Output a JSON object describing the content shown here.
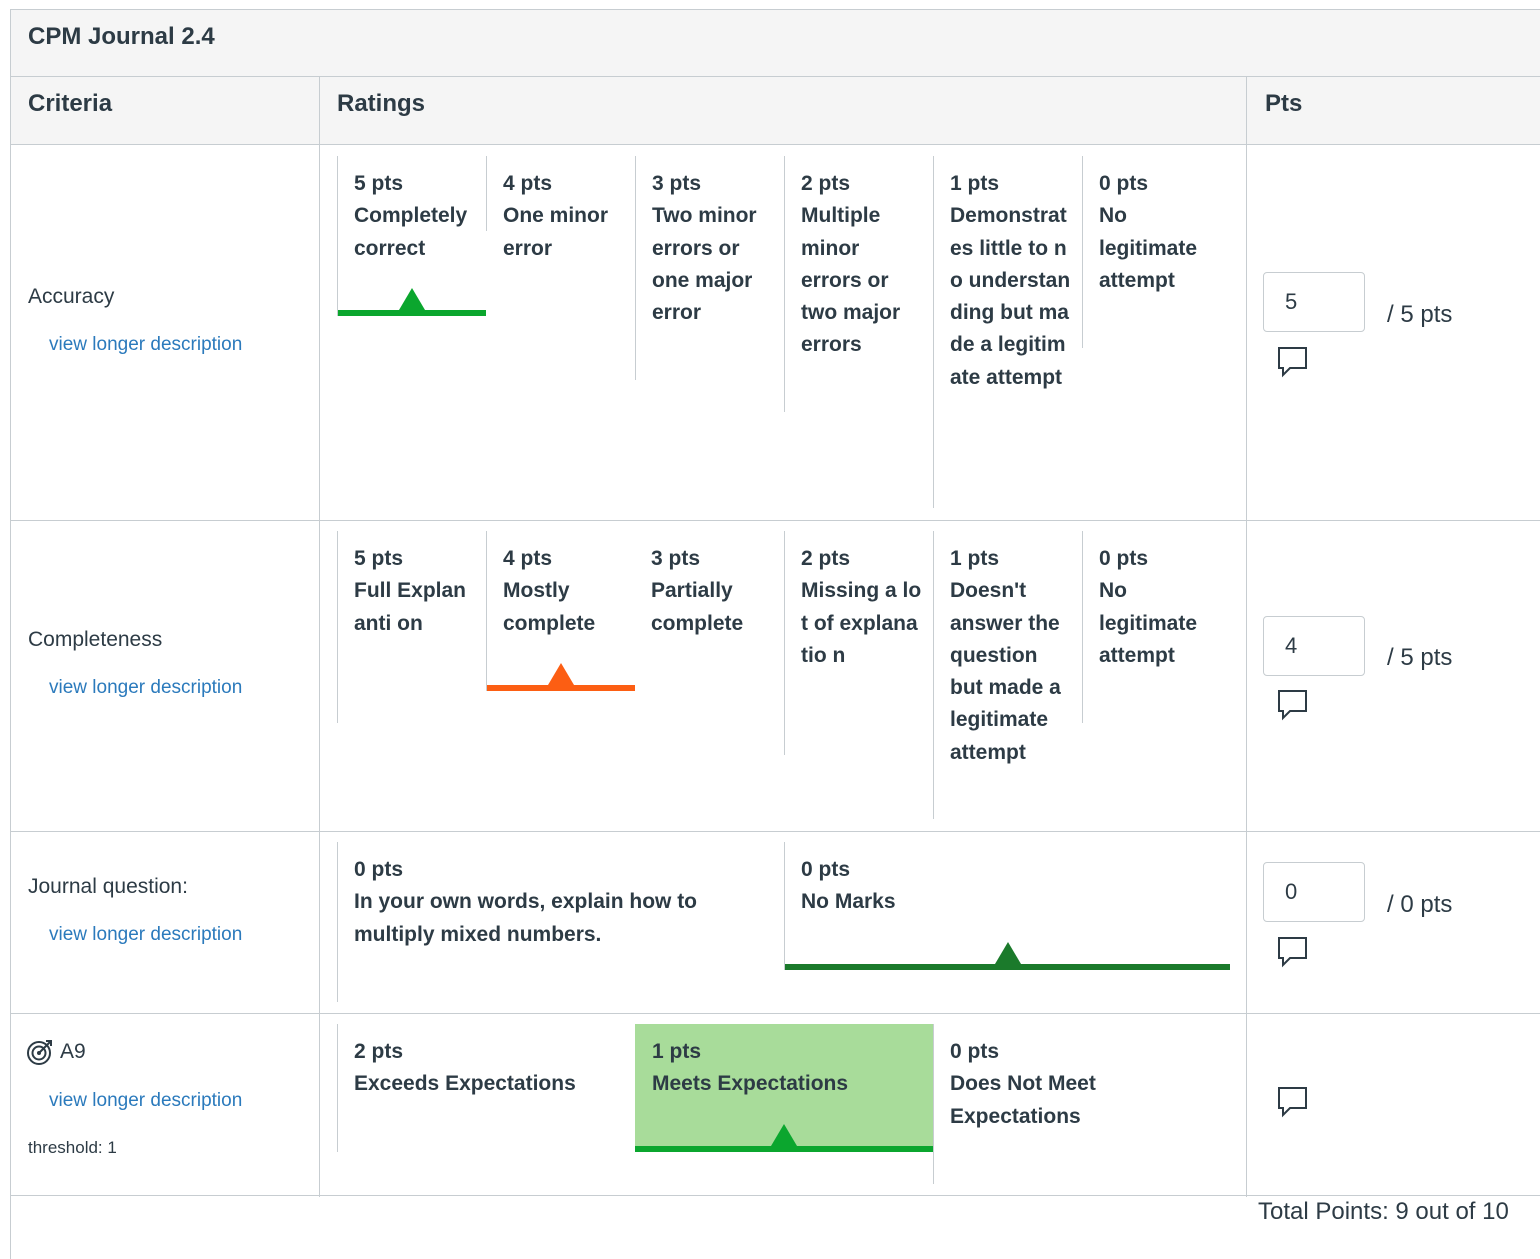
{
  "rubric": {
    "title": "CPM Journal 2.4",
    "headers": {
      "criteria": "Criteria",
      "ratings": "Ratings",
      "pts": "Pts"
    },
    "view_longer_label": "view longer description",
    "criteria": [
      {
        "name": "Accuracy",
        "score": "5",
        "out_of": "/ 5 pts",
        "ratings": [
          {
            "pts": "5 pts",
            "desc": "Completely correct",
            "selected": true
          },
          {
            "pts": "4 pts",
            "desc": "One minor error"
          },
          {
            "pts": "3 pts",
            "desc": "Two minor errors or one major error"
          },
          {
            "pts": "2 pts",
            "desc": "Multiple minor errors or two major errors"
          },
          {
            "pts": "1 pts",
            "desc": "Demonstrates little to no understanding but made a legitimate attempt"
          },
          {
            "pts": "0 pts",
            "desc": "No legitimate attempt"
          }
        ]
      },
      {
        "name": "Completeness",
        "score": "4",
        "out_of": "/ 5 pts",
        "ratings": [
          {
            "pts": "5 pts",
            "desc": "Full Explananti on"
          },
          {
            "pts": "4 pts",
            "desc": "Mostly complete",
            "selected": true
          },
          {
            "pts": "3 pts",
            "desc": "Partially complete"
          },
          {
            "pts": "2 pts",
            "desc": "Missing a lot of explanatio n"
          },
          {
            "pts": "1 pts",
            "desc": "Doesn't answer the question but made a legitimate attempt"
          },
          {
            "pts": "0 pts",
            "desc": "No legitimate attempt"
          }
        ]
      },
      {
        "name": "Journal question:",
        "score": "0",
        "out_of": "/ 0 pts",
        "ratings": [
          {
            "pts": "0 pts",
            "desc": "In your own words, explain how to multiply mixed numbers."
          },
          {
            "pts": "0 pts",
            "desc": "No Marks",
            "selected": true
          }
        ]
      },
      {
        "name": "A9",
        "threshold": "threshold: 1",
        "ratings": [
          {
            "pts": "2 pts",
            "desc": "Exceeds Expectations"
          },
          {
            "pts": "1 pts",
            "desc": "Meets Expectations",
            "selected": true
          },
          {
            "pts": "0 pts",
            "desc": "Does Not Meet Expectations"
          }
        ]
      }
    ],
    "total": "Total Points: 9 out of 10",
    "colors": {
      "selected_green": "#0ba62e",
      "selected_orange": "#fc5e13",
      "selected_dark_green": "#1b7a2b",
      "highlight_bg": "#a8dc9a",
      "link": "#2b7abc",
      "border": "#c7cdd1",
      "header_bg": "#f5f5f5"
    },
    "icons": {
      "comment": "comment-bubble-icon",
      "outcome": "outcome-target-icon"
    }
  }
}
